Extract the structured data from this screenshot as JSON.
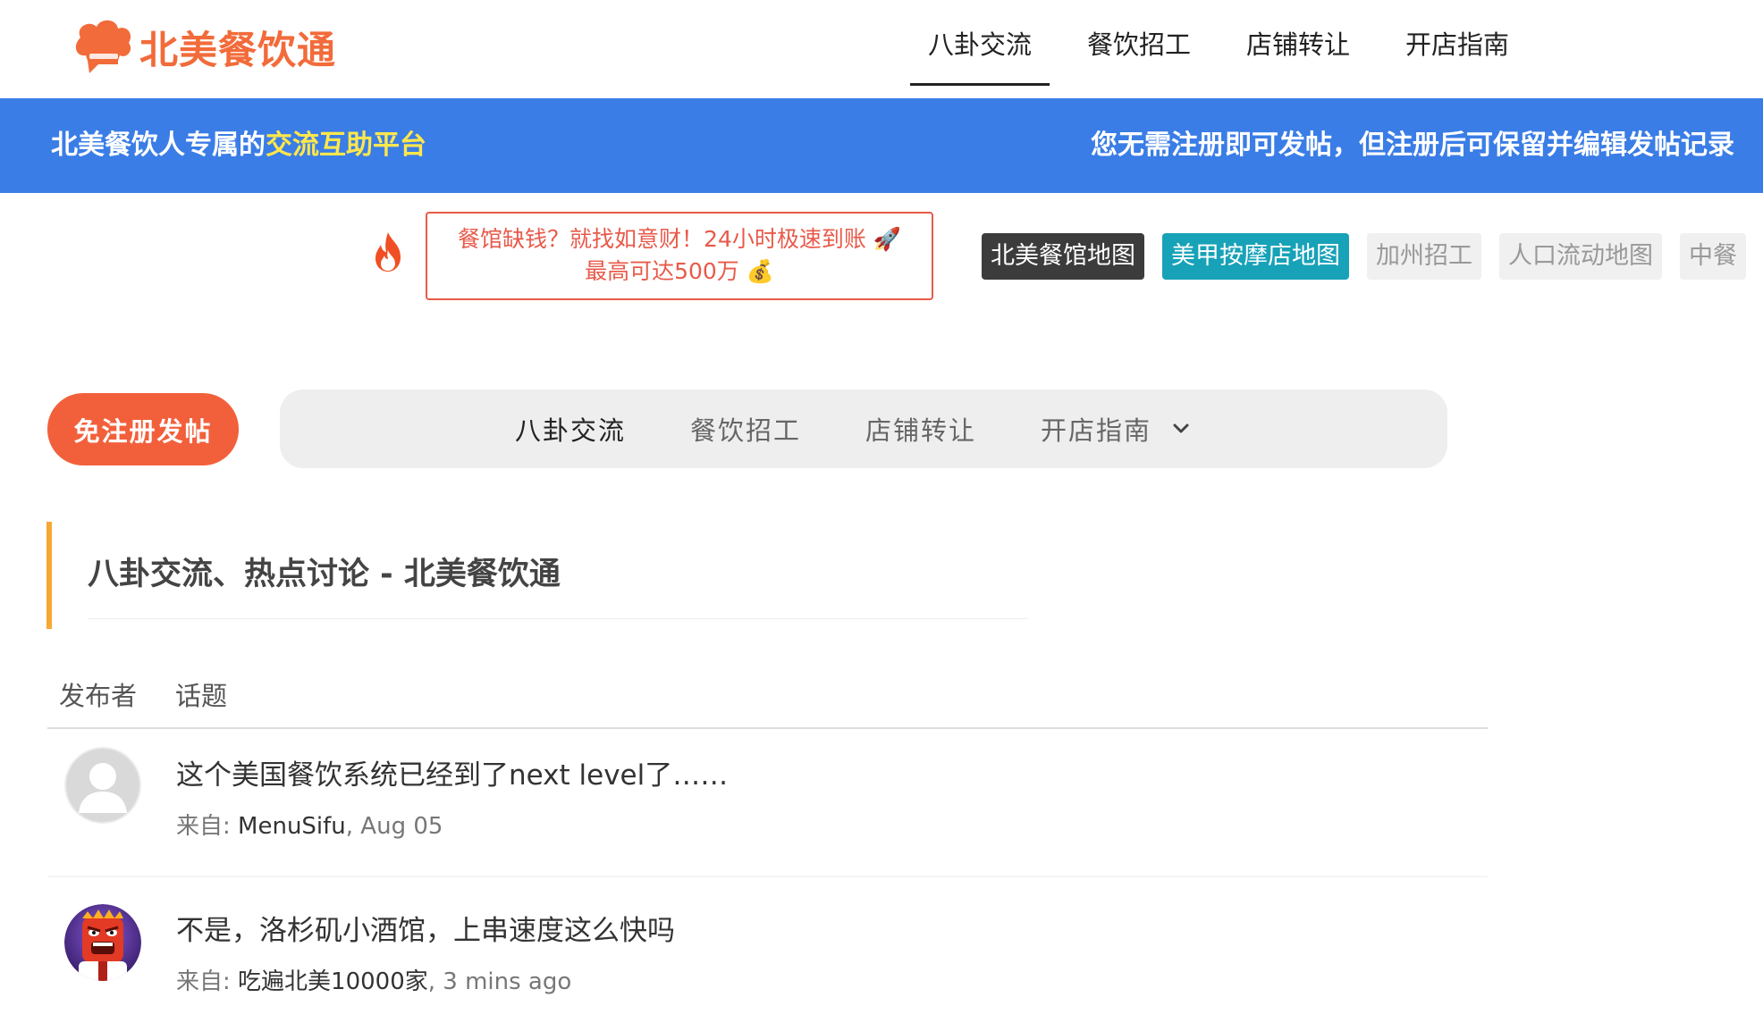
{
  "brand": {
    "name": "北美餐饮通",
    "accent_color": "#f26b3a",
    "logo_icon": "chef-hat-chat-icon"
  },
  "top_nav": {
    "items": [
      {
        "label": "八卦交流",
        "active": true
      },
      {
        "label": "餐饮招工",
        "active": false
      },
      {
        "label": "店铺转让",
        "active": false
      },
      {
        "label": "开店指南",
        "active": false
      }
    ]
  },
  "banner": {
    "left_prefix": "北美餐饮人专属的",
    "left_highlight": "交流互助平台",
    "right_text": "您无需注册即可发帖，但注册后可保留并编辑发帖记录",
    "bg_color": "#3a7de6"
  },
  "promo": {
    "icon": "fire-icon",
    "line1": "餐馆缺钱？就找如意财！24小时极速到账 🚀",
    "line2": "最高可达500万 💰"
  },
  "quick_links": [
    {
      "label": "北美餐馆地图",
      "style": "dark"
    },
    {
      "label": "美甲按摩店地图",
      "style": "teal"
    },
    {
      "label": "加州招工",
      "style": "light"
    },
    {
      "label": "人口流动地图",
      "style": "light"
    },
    {
      "label": "中餐",
      "style": "light"
    }
  ],
  "post_button": {
    "label": "免注册发帖"
  },
  "sub_nav": {
    "items": [
      {
        "label": "八卦交流",
        "active": true
      },
      {
        "label": "餐饮招工",
        "active": false
      },
      {
        "label": "店铺转让",
        "active": false
      },
      {
        "label": "开店指南",
        "active": false
      }
    ],
    "dropdown_icon": "chevron-down-icon"
  },
  "section": {
    "title": "八卦交流、热点讨论 - 北美餐饮通"
  },
  "table": {
    "headers": [
      "发布者",
      "话题"
    ],
    "rows": [
      {
        "topic": "这个美国餐饮系统已经到了next level了……",
        "from_label": "来自:",
        "author": "MenuSifu",
        "time": ", Aug 05",
        "avatar": "default-user-avatar"
      },
      {
        "topic": "不是，洛杉矶小酒馆，上串速度这么快吗",
        "from_label": "来自:",
        "author": "吃遍北美10000家",
        "time": ", 3 mins ago",
        "avatar": "angry-character-avatar"
      }
    ]
  }
}
